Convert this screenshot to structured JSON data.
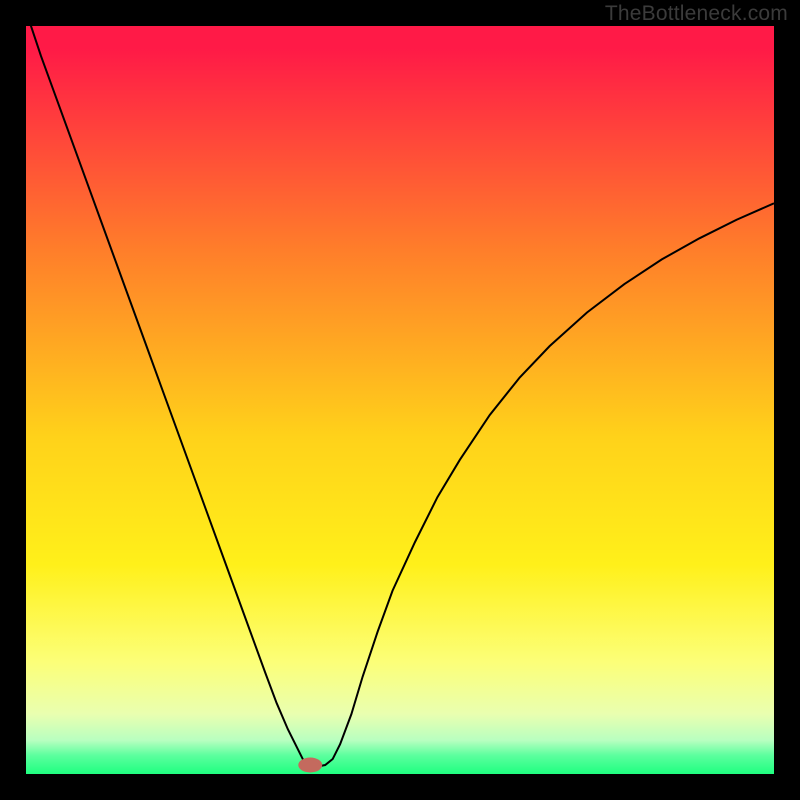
{
  "watermark": "TheBottleneck.com",
  "chart_data": {
    "type": "line",
    "title": "",
    "xlabel": "",
    "ylabel": "",
    "xlim": [
      0,
      100
    ],
    "ylim": [
      0,
      100
    ],
    "background_gradient": {
      "stops": [
        {
          "offset": 0.0,
          "color": "#ff1a47"
        },
        {
          "offset": 0.03,
          "color": "#ff1a47"
        },
        {
          "offset": 0.3,
          "color": "#ff7e2a"
        },
        {
          "offset": 0.55,
          "color": "#ffd21a"
        },
        {
          "offset": 0.72,
          "color": "#fff01a"
        },
        {
          "offset": 0.85,
          "color": "#fcff78"
        },
        {
          "offset": 0.92,
          "color": "#e9ffb0"
        },
        {
          "offset": 0.955,
          "color": "#b8ffc0"
        },
        {
          "offset": 0.975,
          "color": "#5cff9e"
        },
        {
          "offset": 1.0,
          "color": "#1fff80"
        }
      ]
    },
    "curve": {
      "x": [
        0,
        2,
        4,
        6,
        8,
        10,
        12,
        14,
        16,
        18,
        20,
        22,
        24,
        26,
        28,
        30,
        32,
        33.5,
        35,
        36.5,
        37,
        37.5,
        38,
        39,
        40,
        41,
        42,
        43.5,
        45,
        47,
        49,
        52,
        55,
        58,
        62,
        66,
        70,
        75,
        80,
        85,
        90,
        95,
        100
      ],
      "y": [
        102,
        96,
        90.5,
        85,
        79.5,
        74,
        68.5,
        63,
        57.5,
        52,
        46.5,
        41,
        35.5,
        30,
        24.5,
        19,
        13.5,
        9.5,
        6,
        3,
        2,
        1.3,
        1,
        1,
        1.2,
        2,
        4,
        8,
        13,
        19,
        24.5,
        31,
        37,
        42,
        48,
        53,
        57.2,
        61.7,
        65.5,
        68.8,
        71.6,
        74.1,
        76.3
      ]
    },
    "marker": {
      "x": 38.0,
      "y": 1.2,
      "rx": 1.6,
      "ry": 1.0,
      "color": "#c46a5e"
    }
  }
}
